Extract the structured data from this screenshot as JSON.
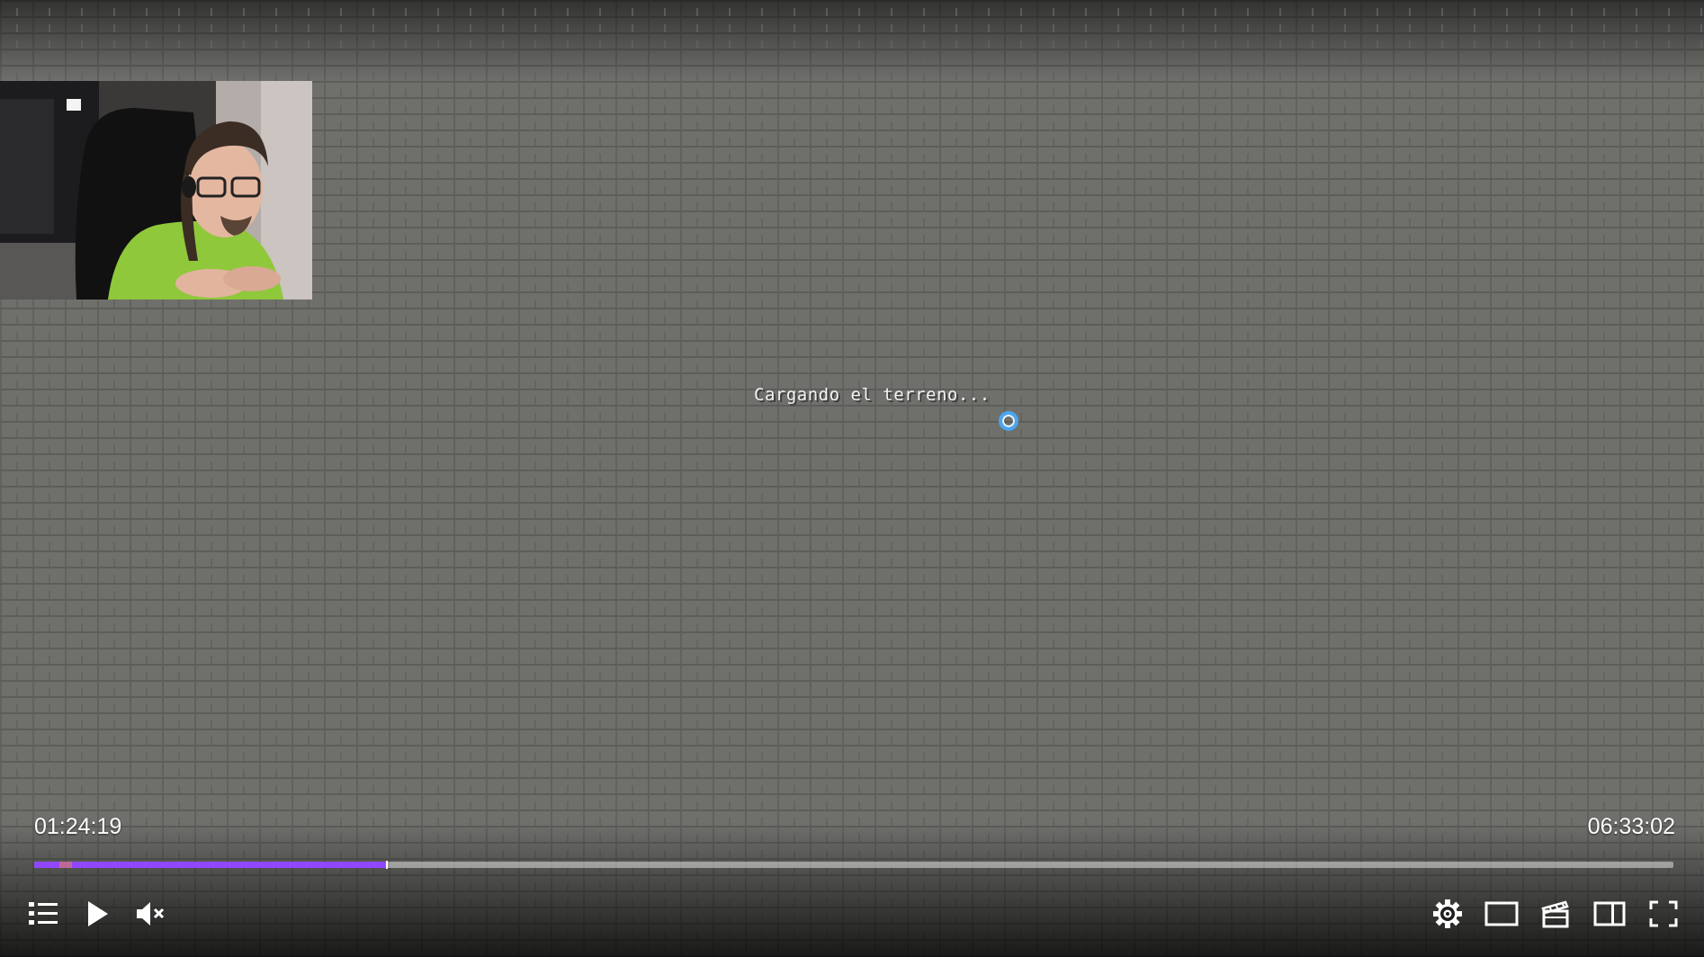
{
  "video": {
    "loading_text": "Cargando el terreno...",
    "current_time": "01:24:19",
    "total_time": "06:33:02",
    "progress_fraction": 0.215
  },
  "controls": {
    "left": [
      {
        "name": "chapters-list-button",
        "icon": "list-icon"
      },
      {
        "name": "play-button",
        "icon": "play-icon"
      },
      {
        "name": "mute-button",
        "icon": "speaker-muted-icon"
      }
    ],
    "right": [
      {
        "name": "settings-button",
        "icon": "gear-icon"
      },
      {
        "name": "theatre-mode-button",
        "icon": "theatre-icon"
      },
      {
        "name": "clip-button",
        "icon": "clapperboard-icon"
      },
      {
        "name": "sidebar-toggle-button",
        "icon": "split-panel-icon"
      },
      {
        "name": "fullscreen-button",
        "icon": "fullscreen-icon"
      }
    ]
  },
  "colors": {
    "accent": "#9147ff",
    "spinner": "#4aa6ef"
  }
}
